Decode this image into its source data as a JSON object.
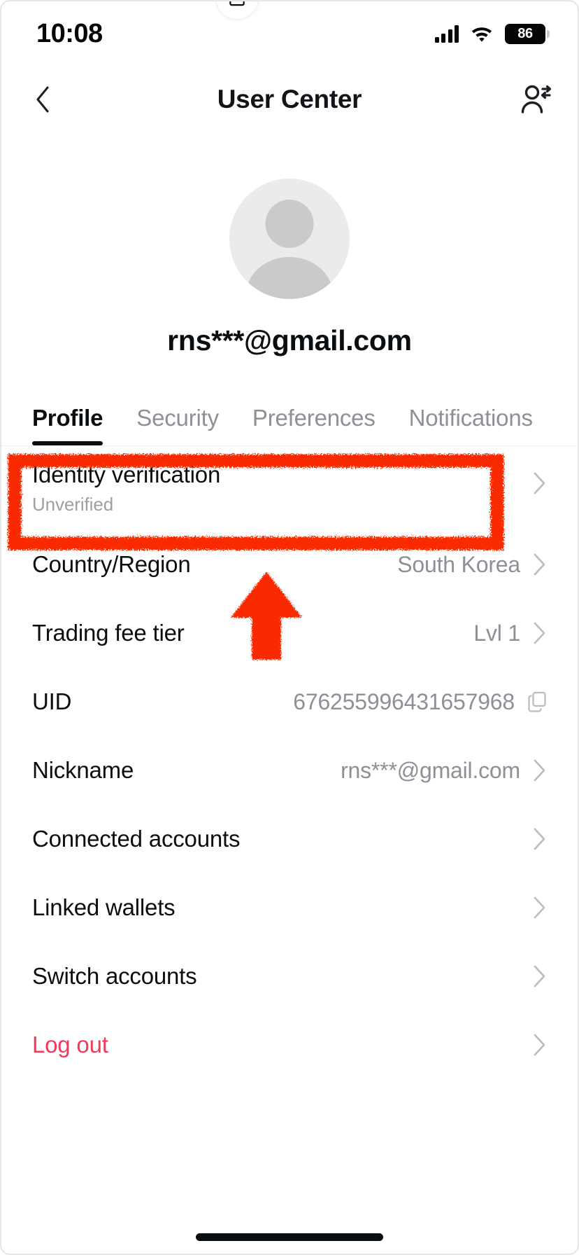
{
  "status_bar": {
    "time": "10:08",
    "battery_level": "86",
    "signal_icon": "cellular-signal-icon",
    "wifi_icon": "wifi-icon",
    "battery_icon": "battery-icon"
  },
  "nav": {
    "back_icon": "chevron-left-icon",
    "title": "User Center",
    "action_icon": "switch-user-icon"
  },
  "profile": {
    "avatar_icon": "default-avatar-icon",
    "edit_icon": "edit-pencil-icon",
    "email": "rns***@gmail.com"
  },
  "tabs": [
    {
      "label": "Profile",
      "active": true
    },
    {
      "label": "Security",
      "active": false
    },
    {
      "label": "Preferences",
      "active": false
    },
    {
      "label": "Notifications",
      "active": false
    }
  ],
  "rows": [
    {
      "label": "Identity verification",
      "sub": "Unverified",
      "value": "",
      "chevron": true,
      "copy": false,
      "highlighted": true
    },
    {
      "label": "Country/Region",
      "sub": "",
      "value": "South Korea",
      "chevron": true,
      "copy": false,
      "highlighted": false
    },
    {
      "label": "Trading fee tier",
      "sub": "",
      "value": "Lvl 1",
      "chevron": true,
      "copy": false,
      "highlighted": false
    },
    {
      "label": "UID",
      "sub": "",
      "value": "676255996431657968",
      "chevron": false,
      "copy": true,
      "highlighted": false
    },
    {
      "label": "Nickname",
      "sub": "",
      "value": "rns***@gmail.com",
      "chevron": true,
      "copy": false,
      "highlighted": false
    },
    {
      "label": "Connected accounts",
      "sub": "",
      "value": "",
      "chevron": true,
      "copy": false,
      "highlighted": false
    },
    {
      "label": "Linked wallets",
      "sub": "",
      "value": "",
      "chevron": true,
      "copy": false,
      "highlighted": false
    },
    {
      "label": "Switch accounts",
      "sub": "",
      "value": "",
      "chevron": true,
      "copy": false,
      "highlighted": false
    },
    {
      "label": "Log out",
      "sub": "",
      "value": "",
      "chevron": true,
      "copy": false,
      "highlighted": false,
      "danger": true
    }
  ],
  "annotations": {
    "highlight_box_target": "Identity verification",
    "arrow_target": "Identity verification",
    "color": "#FA2A00"
  },
  "colors": {
    "text_primary": "#0B0E11",
    "text_secondary": "#8D9197",
    "danger": "#F03B5C",
    "annotation_red": "#FA2A00",
    "avatar_bg": "#EAEBEB",
    "avatar_fg": "#C9CACB"
  }
}
